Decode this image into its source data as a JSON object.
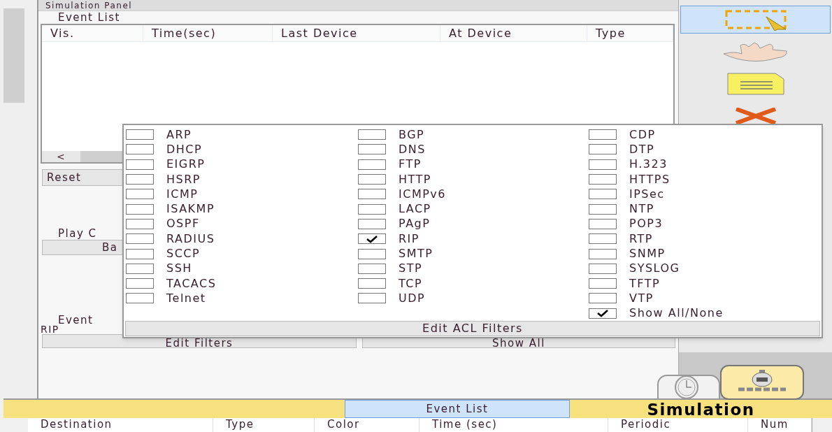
{
  "panel": {
    "title": "Simulation Panel"
  },
  "event_list": {
    "legend": "Event List",
    "columns": [
      "Vis.",
      "Time(sec)",
      "Last Device",
      "At Device",
      "Type"
    ],
    "scroll_left": "<"
  },
  "reset_button": "Reset",
  "play_controls": {
    "legend": "Play C",
    "back_button": "Ba"
  },
  "event_filters": {
    "legend": "Event",
    "current": "RIP",
    "edit_button": "Edit Filters",
    "show_all_button": "Show All"
  },
  "filter_popup": {
    "columns": [
      [
        {
          "label": "ARP",
          "checked": false
        },
        {
          "label": "DHCP",
          "checked": false
        },
        {
          "label": "EIGRP",
          "checked": false
        },
        {
          "label": "HSRP",
          "checked": false
        },
        {
          "label": "ICMP",
          "checked": false
        },
        {
          "label": "ISAKMP",
          "checked": false
        },
        {
          "label": "OSPF",
          "checked": false
        },
        {
          "label": "RADIUS",
          "checked": false
        },
        {
          "label": "SCCP",
          "checked": false
        },
        {
          "label": "SSH",
          "checked": false
        },
        {
          "label": "TACACS",
          "checked": false
        },
        {
          "label": "Telnet",
          "checked": false
        }
      ],
      [
        {
          "label": "BGP",
          "checked": false
        },
        {
          "label": "DNS",
          "checked": false
        },
        {
          "label": "FTP",
          "checked": false
        },
        {
          "label": "HTTP",
          "checked": false
        },
        {
          "label": "ICMPv6",
          "checked": false
        },
        {
          "label": "LACP",
          "checked": false
        },
        {
          "label": "PAgP",
          "checked": false
        },
        {
          "label": "RIP",
          "checked": true
        },
        {
          "label": "SMTP",
          "checked": false
        },
        {
          "label": "STP",
          "checked": false
        },
        {
          "label": "TCP",
          "checked": false
        },
        {
          "label": "UDP",
          "checked": false
        }
      ],
      [
        {
          "label": "CDP",
          "checked": false
        },
        {
          "label": "DTP",
          "checked": false
        },
        {
          "label": "H.323",
          "checked": false
        },
        {
          "label": "HTTPS",
          "checked": false
        },
        {
          "label": "IPSec",
          "checked": false
        },
        {
          "label": "NTP",
          "checked": false
        },
        {
          "label": "POP3",
          "checked": false
        },
        {
          "label": "RTP",
          "checked": false
        },
        {
          "label": "SNMP",
          "checked": false
        },
        {
          "label": "SYSLOG",
          "checked": false
        },
        {
          "label": "TFTP",
          "checked": false
        },
        {
          "label": "VTP",
          "checked": false
        },
        {
          "label": "Show All/None",
          "checked": true
        }
      ]
    ],
    "acl_button": "Edit ACL Filters"
  },
  "tools": [
    {
      "kind": "select",
      "selected": true
    },
    {
      "kind": "hand",
      "selected": false
    },
    {
      "kind": "note",
      "selected": false
    },
    {
      "kind": "delete",
      "selected": false
    }
  ],
  "modes": [
    {
      "kind": "realtime",
      "selected": false
    },
    {
      "kind": "simulation",
      "selected": true
    }
  ],
  "bottom_bar": {
    "event_list_button": "Event List",
    "mode_label": "Simulation"
  },
  "pdu_table": {
    "columns": [
      "Destination",
      "Type",
      "Color",
      "Time (sec)",
      "Periodic",
      "Num"
    ]
  }
}
